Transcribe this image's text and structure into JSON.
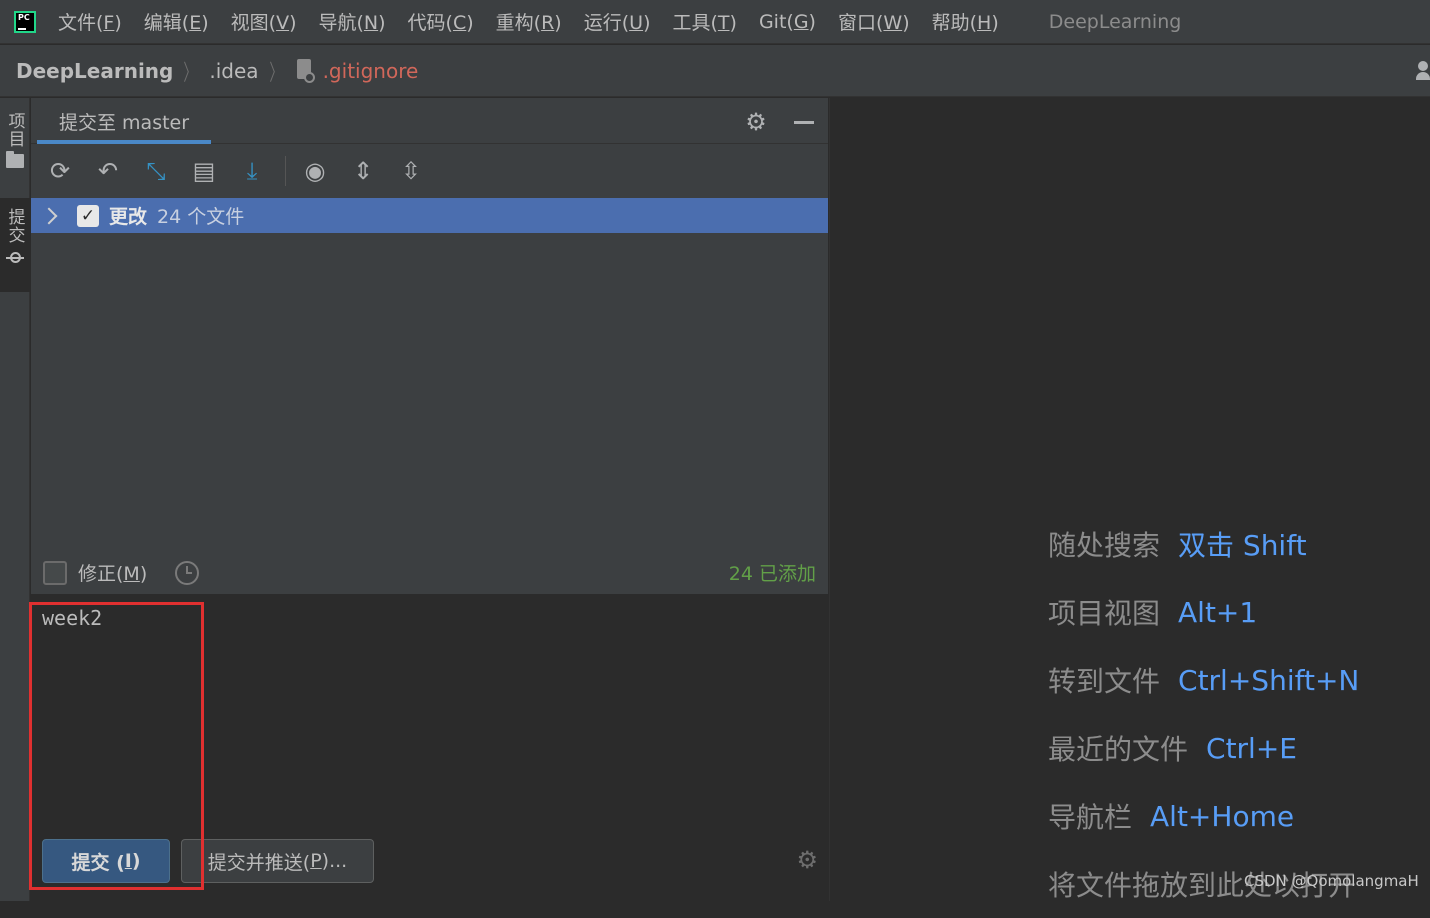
{
  "menubar": {
    "items": [
      {
        "text": "文件(",
        "key": "F",
        "tail": ")"
      },
      {
        "text": "编辑(",
        "key": "E",
        "tail": ")"
      },
      {
        "text": "视图(",
        "key": "V",
        "tail": ")"
      },
      {
        "text": "导航(",
        "key": "N",
        "tail": ")"
      },
      {
        "text": "代码(",
        "key": "C",
        "tail": ")"
      },
      {
        "text": "重构(",
        "key": "R",
        "tail": ")"
      },
      {
        "text": "运行(",
        "key": "U",
        "tail": ")"
      },
      {
        "text": "工具(",
        "key": "T",
        "tail": ")"
      },
      {
        "text": "Git(",
        "key": "G",
        "tail": ")"
      },
      {
        "text": "窗口(",
        "key": "W",
        "tail": ")"
      },
      {
        "text": "帮助(",
        "key": "H",
        "tail": ")"
      }
    ],
    "window_title": "DeepLearning",
    "logo_text": "PC"
  },
  "breadcrumb": {
    "project": "DeepLearning",
    "folder": ".idea",
    "file": ".gitignore"
  },
  "left_stripe": {
    "project_tab": "项目",
    "commit_tab": "提交"
  },
  "commit_panel": {
    "tab_label": "提交至 master",
    "changes_node": {
      "label": "更改",
      "count": "24 个文件"
    },
    "amend": {
      "label": "修正(",
      "key": "M",
      "tail": ")"
    },
    "added_status": "24 已添加",
    "message": "week2",
    "commit_button": {
      "text": "提交 (",
      "key": "I",
      "tail": ")"
    },
    "commit_push_button": {
      "text": "提交并推送(",
      "key": "P",
      "tail": ")..."
    }
  },
  "editor_hints": [
    {
      "text": "随处搜索",
      "key": "双击 Shift"
    },
    {
      "text": "项目视图",
      "key": "Alt+1"
    },
    {
      "text": "转到文件",
      "key": "Ctrl+Shift+N"
    },
    {
      "text": "最近的文件",
      "key": "Ctrl+E"
    },
    {
      "text": "导航栏",
      "key": "Alt+Home"
    },
    {
      "text": "将文件拖放到此处以打开",
      "key": ""
    }
  ],
  "watermark": "CSDN @QomolangmaH",
  "colors": {
    "accent": "#4a88c7",
    "selection": "#4b6eaf",
    "added": "#62a048",
    "shortcut": "#589df6",
    "ignored_file": "#d1675a",
    "highlight": "#e03030"
  },
  "icons": {
    "toolbar": [
      "refresh-icon",
      "rollback-icon",
      "show-diff-icon",
      "shelve-icon",
      "update-icon",
      "view-options-icon",
      "expand-all-icon",
      "collapse-all-icon"
    ]
  }
}
